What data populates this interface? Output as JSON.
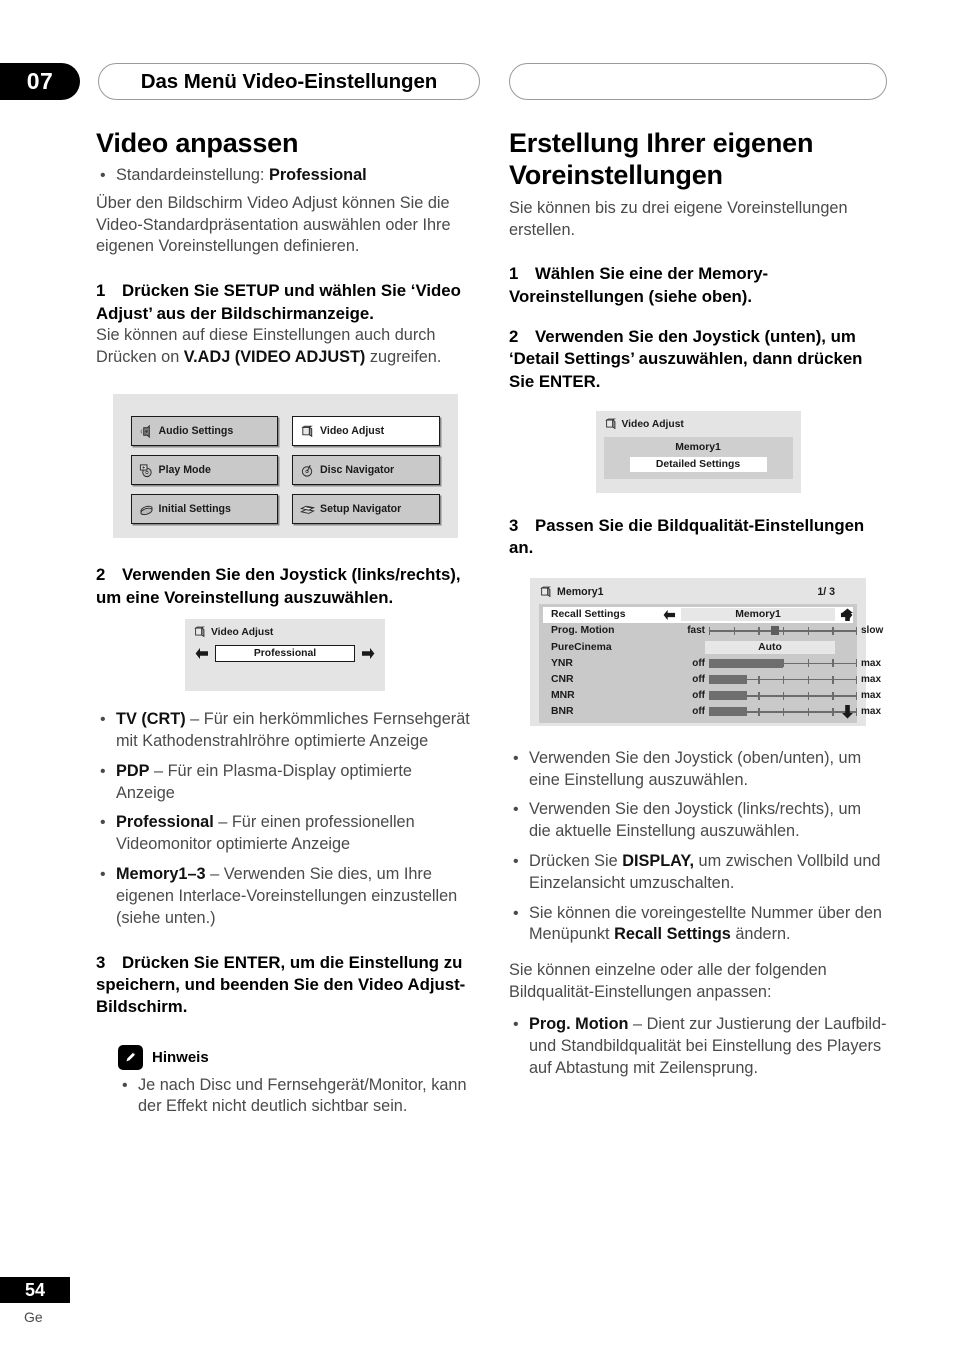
{
  "header": {
    "chapter_number": "07",
    "chapter_title": "Das Menü Video-Einstellungen",
    "right_pill_title": ""
  },
  "footer": {
    "page_number": "54",
    "language_code": "Ge"
  },
  "left_column": {
    "section_title": "Video anpassen",
    "default_bullet_label": "Standardeinstellung:",
    "default_bullet_value": "Professional",
    "intro_paragraph": "Über den Bildschirm Video Adjust können Sie die Video-Standardpräsentation auswählen oder Ihre eigenen Voreinstellungen definieren.",
    "step1_num": "1",
    "step1_text": "Drücken Sie SETUP und wählen Sie ‘Video Adjust’ aus der Bildschirmanzeige.",
    "step1_body_a": "Sie können auf diese Einstellungen auch durch Drücken on ",
    "step1_body_bold": "V.ADJ (VIDEO ADJUST)",
    "step1_body_b": " zugreifen.",
    "menu_screen": {
      "items": [
        {
          "label": "Audio Settings",
          "icon": "speaker-icon",
          "selected": false
        },
        {
          "label": "Video Adjust",
          "icon": "monitor-icon",
          "selected": true
        },
        {
          "label": "Play Mode",
          "icon": "disc-play-icon",
          "selected": false
        },
        {
          "label": "Disc Navigator",
          "icon": "disc-navigator-icon",
          "selected": false
        },
        {
          "label": "Initial Settings",
          "icon": "disc-stack-icon",
          "selected": false
        },
        {
          "label": "Setup Navigator",
          "icon": "setup-navigator-icon",
          "selected": false
        }
      ]
    },
    "step2_num": "2",
    "step2_text": "Verwenden Sie den Joystick (links/rechts), um eine Voreinstellung auszuwählen.",
    "preset_screen": {
      "title": "Video Adjust",
      "value": "Professional"
    },
    "preset_bullets": [
      {
        "term": "TV (CRT)",
        "dash": " – ",
        "desc": "Für ein herkömmliches Fernsehgerät mit Kathodenstrahlröhre optimierte Anzeige"
      },
      {
        "term": "PDP",
        "dash": " – ",
        "desc": "Für ein Plasma-Display optimierte Anzeige"
      },
      {
        "term": "Professional",
        "dash": " – ",
        "desc": "Für einen professionellen Videomonitor optimierte Anzeige"
      },
      {
        "term": "Memory1–3",
        "dash": " – ",
        "desc": "Verwenden Sie dies, um Ihre eigenen Interlace-Voreinstellungen einzustellen (siehe unten.)"
      }
    ],
    "step3_num": "3",
    "step3_text": "Drücken Sie ENTER, um die Einstellung zu speichern, und beenden Sie den Video Adjust-Bildschirm.",
    "note_label": "Hinweis",
    "note_icon": "pencil-icon",
    "note_bullets": [
      "Je nach Disc und Fernsehgerät/Monitor, kann der Effekt nicht deutlich sichtbar sein."
    ]
  },
  "right_column": {
    "section_title_line1": "Erstellung Ihrer eigenen",
    "section_title_line2": "Voreinstellungen",
    "intro_paragraph": "Sie können bis zu drei eigene Voreinstellungen erstellen.",
    "step1_num": "1",
    "step1_text": "Wählen Sie eine der Memory-Voreinstellungen (siehe oben).",
    "step2_num": "2",
    "step2_text": "Verwenden Sie den Joystick (unten), um ‘Detail Settings’ auszuwählen, dann drücken Sie ENTER.",
    "memory_screen": {
      "title": "Video Adjust",
      "memory_label": "Memory1",
      "selected_item": "Detailed Settings"
    },
    "step3_num": "3",
    "step3_text": "Passen Sie die Bildqualität-Einstellungen an.",
    "panel_screen": {
      "title": "Memory1",
      "page_indicator": "1/ 3",
      "rows": [
        {
          "label": "Recall Settings",
          "type": "selector",
          "value": "Memory1",
          "highlighted": true
        },
        {
          "label": "Prog. Motion",
          "type": "slider_knob",
          "min_label": "fast",
          "max_label": "slow",
          "knob_percent": 42,
          "ticks": 7
        },
        {
          "label": "PureCinema",
          "type": "option",
          "value": "Auto",
          "highlighted": false
        },
        {
          "label": "YNR",
          "type": "slider_fill",
          "min_label": "off",
          "max_label": "max",
          "fill_percent": 50,
          "ticks": 7
        },
        {
          "label": "CNR",
          "type": "slider_fill",
          "min_label": "off",
          "max_label": "max",
          "fill_percent": 26,
          "ticks": 7
        },
        {
          "label": "MNR",
          "type": "slider_fill",
          "min_label": "off",
          "max_label": "max",
          "fill_percent": 26,
          "ticks": 7
        },
        {
          "label": "BNR",
          "type": "slider_fill",
          "min_label": "off",
          "max_label": "max",
          "fill_percent": 26,
          "ticks": 7
        }
      ],
      "scroll_up_icon": "arrow-up-icon",
      "scroll_down_icon": "arrow-down-icon"
    },
    "panel_bullets": [
      {
        "pre": "",
        "bold": "",
        "post": "Verwenden Sie den Joystick (oben/unten), um eine Einstellung auszuwählen."
      },
      {
        "pre": "",
        "bold": "",
        "post": "Verwenden Sie den Joystick (links/rechts), um die aktuelle Einstellung auszuwählen."
      },
      {
        "pre": "Drücken Sie ",
        "bold": "DISPLAY,",
        "post": " um zwischen Vollbild und Einzelansicht umzuschalten."
      },
      {
        "pre": "Sie können die voreingestellte Nummer über den Menüpunkt ",
        "bold": "Recall Settings",
        "post": " ändern."
      }
    ],
    "closing_paragraph": "Sie können einzelne oder alle der folgenden Bildqualität-Einstellungen anpassen:",
    "final_bullets": [
      {
        "term": "Prog. Motion",
        "dash": " – ",
        "desc": "Dient zur Justierung der Laufbild- und Standbildqualität bei Einstellung des Players auf Abtastung mit Zeilensprung."
      }
    ]
  }
}
